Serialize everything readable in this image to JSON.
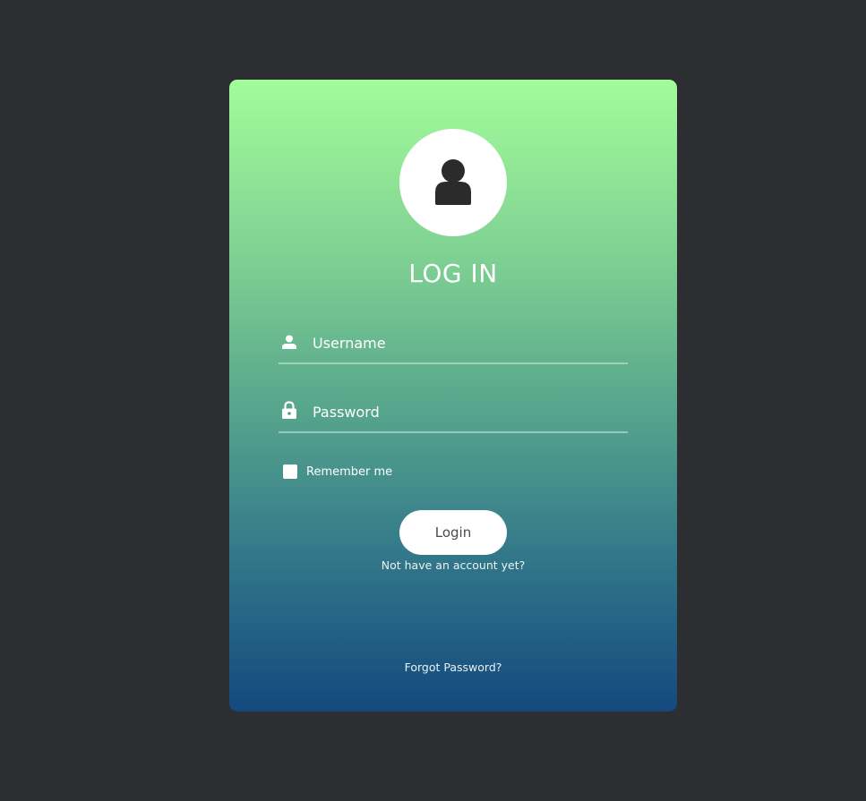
{
  "login": {
    "title": "LOG IN",
    "avatar_icon": "user-avatar-icon",
    "username": {
      "placeholder": "Username",
      "value": "",
      "icon": "user-icon"
    },
    "password": {
      "placeholder": "Password",
      "value": "",
      "icon": "lock-icon"
    },
    "remember_label": "Remember me",
    "remember_checked": false,
    "submit_label": "Login",
    "signup_link": "Not have an account yet?",
    "forgot_link": "Forgot Password?"
  },
  "colors": {
    "background": "#2d2e32",
    "gradient_top": "#a3fd9a",
    "gradient_bottom": "#13497e",
    "icon_dark": "#2b2b2b"
  }
}
